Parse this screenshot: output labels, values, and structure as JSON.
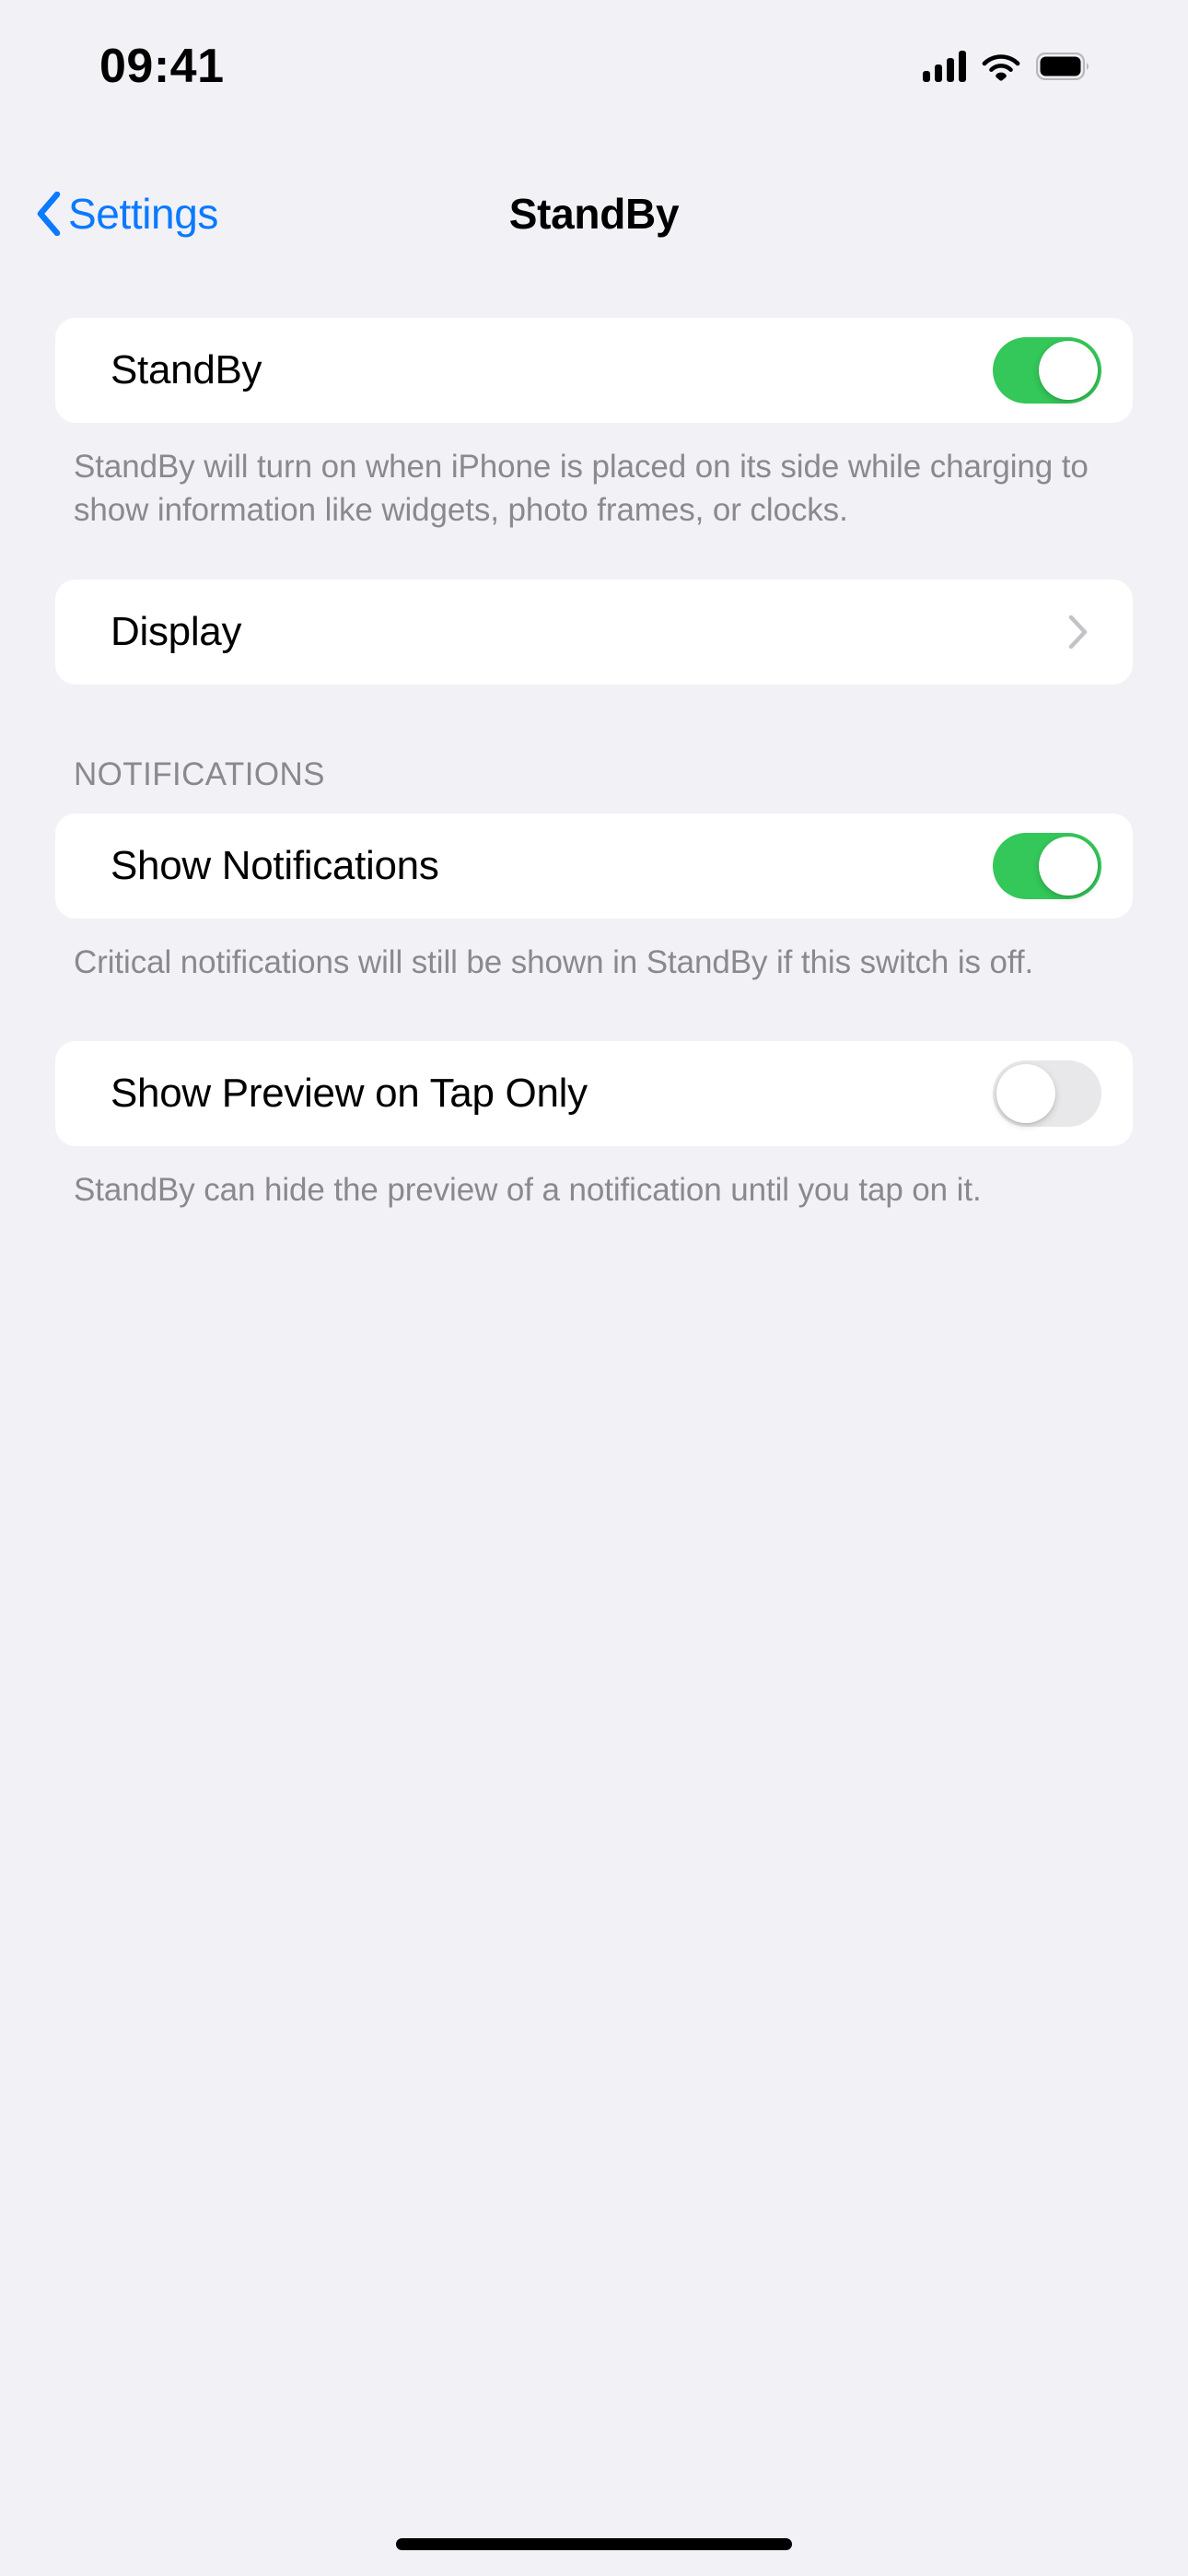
{
  "status_bar": {
    "time": "09:41",
    "signal_icon": "cellular-signal-icon",
    "wifi_icon": "wifi-icon",
    "battery_icon": "battery-full-icon"
  },
  "nav": {
    "back_label": "Settings",
    "back_icon": "chevron-left-icon",
    "title": "StandBy"
  },
  "sections": {
    "standby": {
      "row_label": "StandBy",
      "toggle_state": "on",
      "footer": "StandBy will turn on when iPhone is placed on its side while charging to show information like widgets, photo frames, or clocks."
    },
    "display": {
      "row_label": "Display",
      "disclosure_icon": "chevron-right-icon"
    },
    "notifications": {
      "header": "NOTIFICATIONS",
      "show_notifications": {
        "row_label": "Show Notifications",
        "toggle_state": "on",
        "footer": "Critical notifications will still be shown in StandBy if this switch is off."
      },
      "show_preview": {
        "row_label": "Show Preview on Tap Only",
        "toggle_state": "off",
        "footer": "StandBy can hide the preview of a notification until you tap on it."
      }
    }
  },
  "colors": {
    "background": "#F2F1F6",
    "card": "#FFFFFF",
    "accent_blue": "#0A7AFF",
    "toggle_on_green": "#34C759",
    "toggle_off_gray": "#E8E8EA",
    "secondary_text": "#8A8A8E"
  },
  "home_indicator": "home-indicator"
}
